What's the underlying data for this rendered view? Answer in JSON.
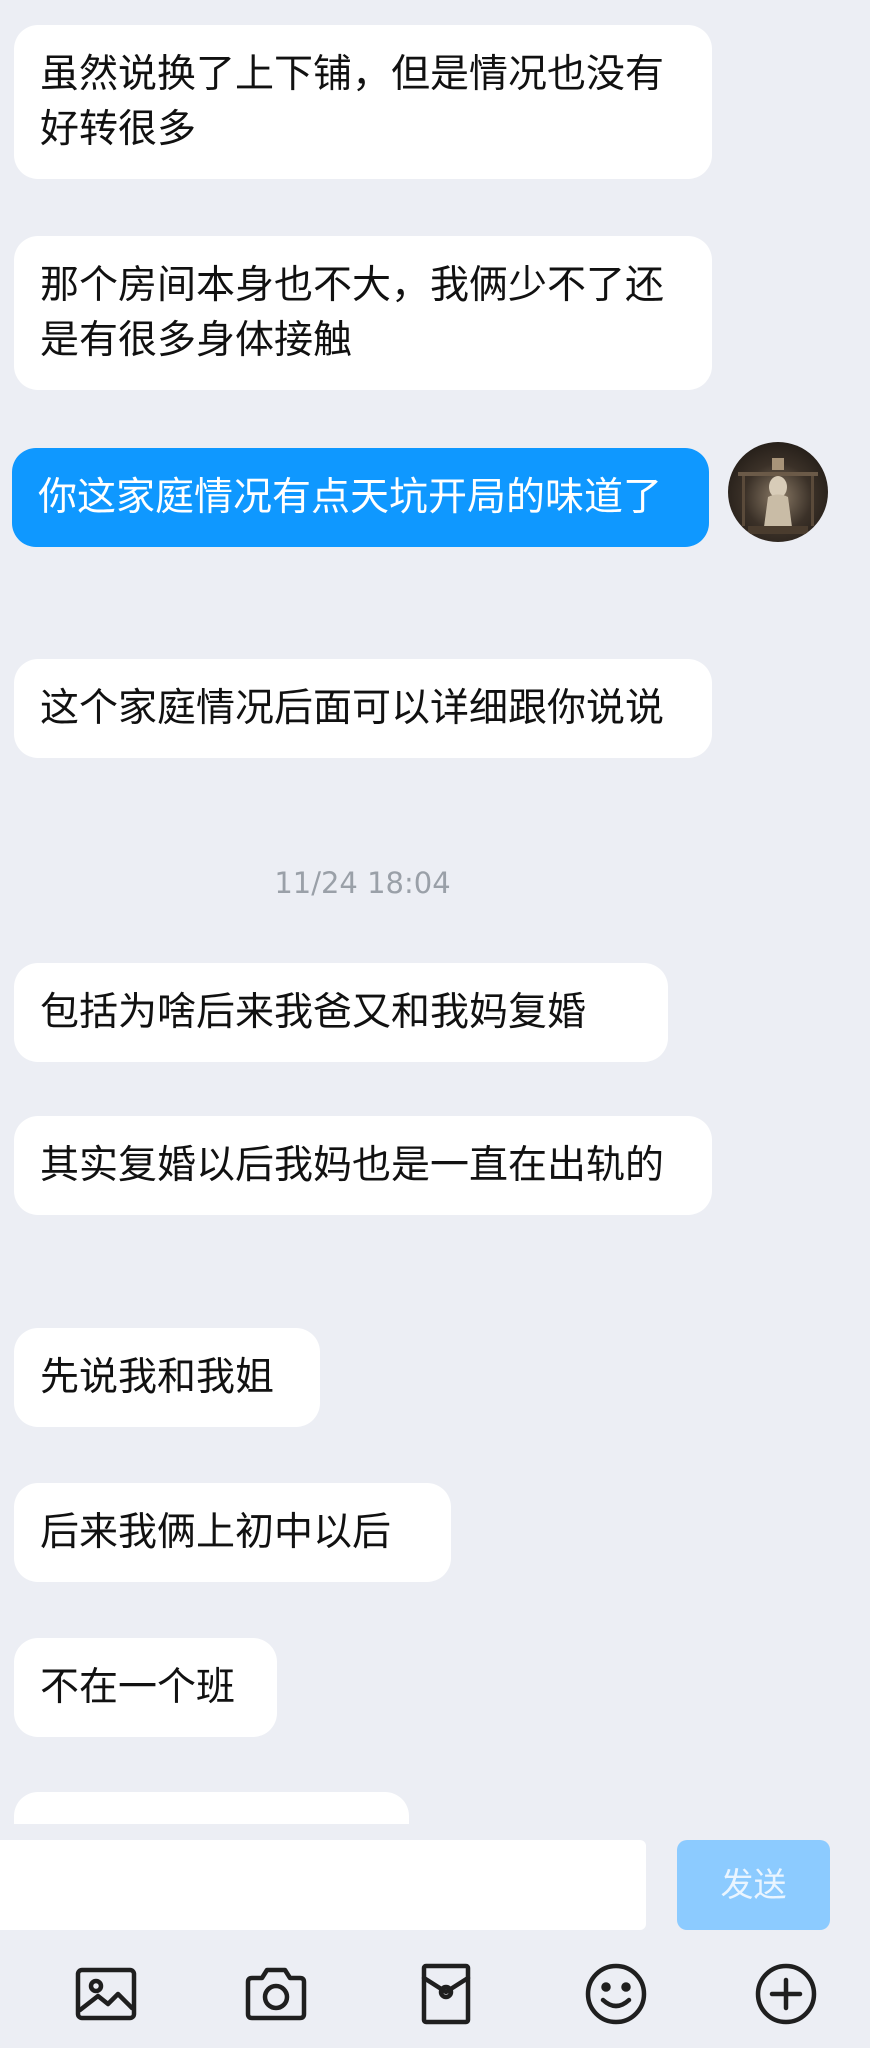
{
  "conversation": {
    "messages": [
      {
        "side": "incoming",
        "text": "虽然说换了上下铺，但是情况也没有好转很多"
      },
      {
        "side": "incoming",
        "text": "那个房间本身也不大，我俩少不了还是有很多身体接触"
      },
      {
        "side": "outgoing",
        "text": "你这家庭情况有点天坑开局的味道了"
      },
      {
        "side": "incoming",
        "text": "这个家庭情况后面可以详细跟你说说"
      },
      {
        "side": "incoming",
        "text": "包括为啥后来我爸又和我妈复婚"
      },
      {
        "side": "incoming",
        "text": "其实复婚以后我妈也是一直在出轨的"
      },
      {
        "side": "incoming",
        "text": "先说我和我姐"
      },
      {
        "side": "incoming",
        "text": "后来我俩上初中以后"
      },
      {
        "side": "incoming",
        "text": "不在一个班"
      },
      {
        "side": "incoming",
        "text": ""
      }
    ],
    "timestamp": "11/24 18:04"
  },
  "input": {
    "value": "",
    "placeholder": "",
    "send_label": "发送"
  },
  "toolbar": {
    "icons": [
      "image-icon",
      "camera-icon",
      "red-packet-icon",
      "emoji-icon",
      "plus-icon"
    ]
  },
  "colors": {
    "background": "#eceef4",
    "incoming_bubble": "#ffffff",
    "outgoing_bubble": "#0f98ff",
    "send_button_disabled": "#8ccbff",
    "timestamp_text": "#9aa0a8",
    "icon_stroke": "#1f1f1f"
  }
}
